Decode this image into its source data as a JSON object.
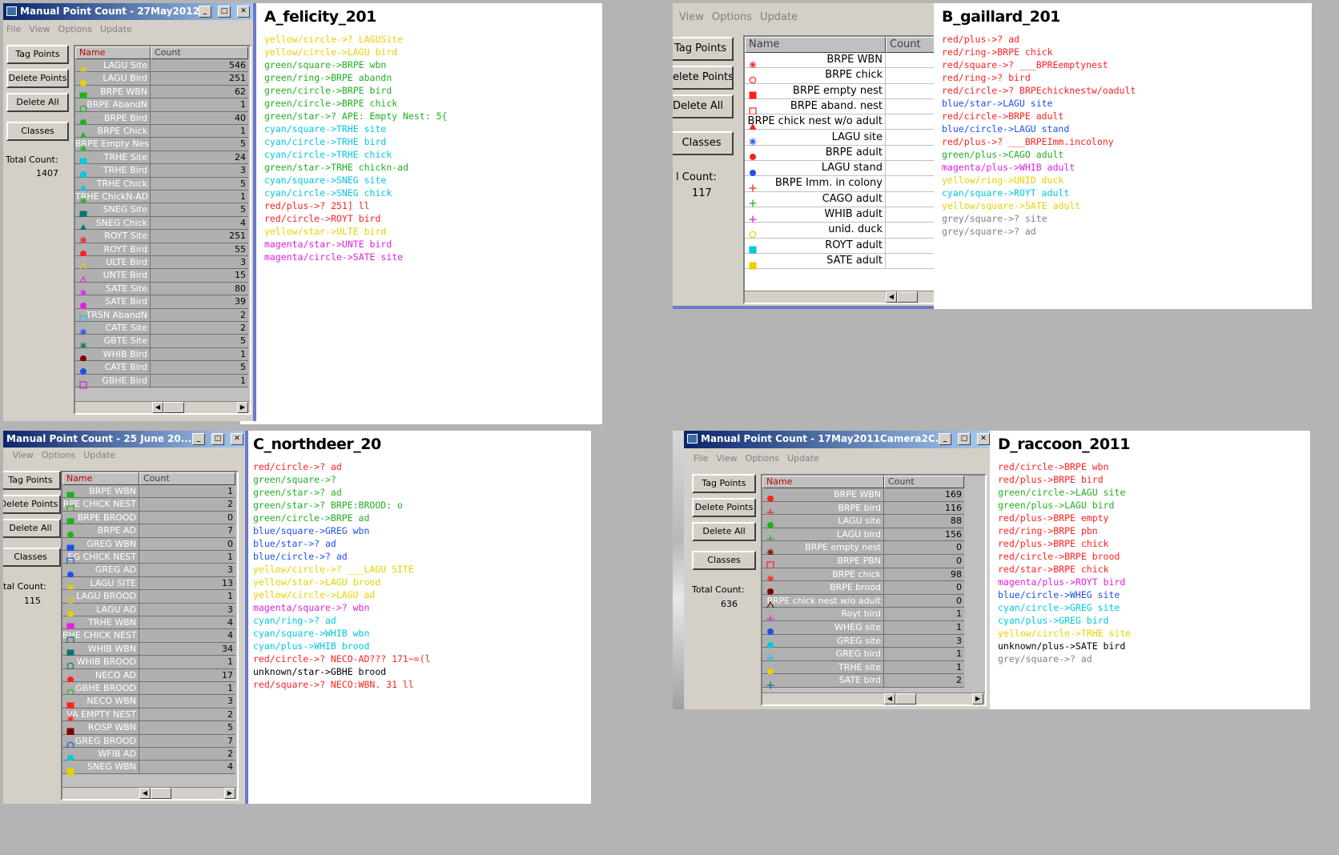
{
  "menus": [
    "File",
    "View",
    "Options",
    "Update"
  ],
  "buttons": {
    "tag": "Tag Points",
    "del": "Delete Points",
    "delall": "Delete All",
    "classes": "Classes"
  },
  "tot_label": "Total Count:",
  "cols": {
    "name": "Name",
    "count": "Count"
  },
  "colors": {
    "red": "#ff2020",
    "green": "#20b020",
    "yellow": "#e8d000",
    "cyan": "#00c8e0",
    "magenta": "#e020e0",
    "blue": "#2050e8",
    "grey": "#808080",
    "unknown": "#000000",
    "darkred": "#800000",
    "teal": "#107070"
  },
  "A": {
    "window_title": "Manual Point Count - 27May2012...",
    "total": "1407",
    "title": "A_felicity_201",
    "rows": [
      {
        "n": "LAGU Site",
        "c": "546",
        "m": "star",
        "col": "yellow"
      },
      {
        "n": "LAGU Bird",
        "c": "251",
        "m": "circle",
        "col": "yellow"
      },
      {
        "n": "BRPE WBN",
        "c": "62",
        "m": "square",
        "col": "green"
      },
      {
        "n": "BRPE AbandN",
        "c": "1",
        "m": "ring",
        "col": "green"
      },
      {
        "n": "BRPE Bird",
        "c": "40",
        "m": "circle",
        "col": "green"
      },
      {
        "n": "BRPE Chick",
        "c": "1",
        "m": "tri",
        "col": "green"
      },
      {
        "n": "BRPE Empty Nest",
        "c": "5",
        "m": "star",
        "col": "green"
      },
      {
        "n": "TRHE Site",
        "c": "24",
        "m": "square",
        "col": "cyan"
      },
      {
        "n": "TRHE Bird",
        "c": "3",
        "m": "circle",
        "col": "cyan"
      },
      {
        "n": "TRHE Chick",
        "c": "5",
        "m": "tri",
        "col": "cyan"
      },
      {
        "n": "TRHE ChickN-AD",
        "c": "1",
        "m": "star",
        "col": "green"
      },
      {
        "n": "SNEG Site",
        "c": "5",
        "m": "square",
        "col": "teal"
      },
      {
        "n": "SNEG Chick",
        "c": "4",
        "m": "tri",
        "col": "teal"
      },
      {
        "n": "ROYT Site",
        "c": "251",
        "m": "star",
        "col": "red"
      },
      {
        "n": "ROYT Bird",
        "c": "55",
        "m": "circle",
        "col": "red"
      },
      {
        "n": "ULTE Bird",
        "c": "3",
        "m": "trio",
        "col": "yellow"
      },
      {
        "n": "UNTE Bird",
        "c": "15",
        "m": "trio",
        "col": "magenta"
      },
      {
        "n": "SATE Site",
        "c": "80",
        "m": "star",
        "col": "magenta"
      },
      {
        "n": "SATE Bird",
        "c": "39",
        "m": "circle",
        "col": "magenta"
      },
      {
        "n": "TRSN AbandN",
        "c": "2",
        "m": "sqo",
        "col": "cyan"
      },
      {
        "n": "CATE Site",
        "c": "2",
        "m": "star",
        "col": "blue"
      },
      {
        "n": "GBTE Site",
        "c": "5",
        "m": "star",
        "col": "teal"
      },
      {
        "n": "WHIB Bird",
        "c": "1",
        "m": "circle",
        "col": "darkred"
      },
      {
        "n": "CATE Bird",
        "c": "5",
        "m": "circle",
        "col": "blue"
      },
      {
        "n": "GBHE Bird",
        "c": "1",
        "m": "sqo",
        "col": "magenta"
      }
    ],
    "lines": [
      {
        "t": "yellow/circle->? LAGUSite",
        "col": "yellow"
      },
      {
        "t": "yellow/circle->LAGU bird",
        "col": "yellow"
      },
      {
        "t": "green/square->BRPE wbn",
        "col": "green"
      },
      {
        "t": "green/ring->BRPE abandn",
        "col": "green"
      },
      {
        "t": "green/circle->BRPE bird",
        "col": "green"
      },
      {
        "t": "green/circle->BRPE chick",
        "col": "green"
      },
      {
        "t": "green/star->? APE: Empty Nest: 5{",
        "col": "green"
      },
      {
        "t": "cyan/square->TRHE site",
        "col": "cyan"
      },
      {
        "t": "cyan/circle->TRHE bird",
        "col": "cyan"
      },
      {
        "t": "cyan/circle->TRHE chick",
        "col": "cyan"
      },
      {
        "t": "green/star->TRHE chickn-ad",
        "col": "green"
      },
      {
        "t": "cyan/square->SNEG site",
        "col": "cyan"
      },
      {
        "t": "cyan/circle->SNEG chick",
        "col": "cyan"
      },
      {
        "t": "red/plus->? 251] ll",
        "col": "red"
      },
      {
        "t": "red/circle->ROYT bird",
        "col": "red"
      },
      {
        "t": "yellow/star->ULTE bird",
        "col": "yellow"
      },
      {
        "t": "magenta/star->UNTE bird",
        "col": "magenta"
      },
      {
        "t": "magenta/circle->SATE site",
        "col": "magenta"
      }
    ]
  },
  "B": {
    "title": "B_gaillard_201",
    "total_label": "l Count:",
    "total": "117",
    "rows": [
      {
        "n": "BRPE WBN",
        "c": "",
        "m": "star",
        "col": "red"
      },
      {
        "n": "BRPE chick",
        "c": "",
        "m": "ring",
        "col": "red"
      },
      {
        "n": "BRPE empty nest",
        "c": "",
        "m": "square",
        "col": "red"
      },
      {
        "n": "BRPE aband. nest",
        "c": "",
        "m": "sqo",
        "col": "red"
      },
      {
        "n": "BRPE chick nest w/o adult",
        "c": "",
        "m": "tri",
        "col": "red"
      },
      {
        "n": "LAGU site",
        "c": "",
        "m": "star",
        "col": "blue"
      },
      {
        "n": "BRPE adult",
        "c": "",
        "m": "circle",
        "col": "red"
      },
      {
        "n": "LAGU stand",
        "c": "",
        "m": "circle",
        "col": "blue"
      },
      {
        "n": "BRPE Imm. in colony",
        "c": "",
        "m": "plus",
        "col": "red"
      },
      {
        "n": "CAGO adult",
        "c": "",
        "m": "plus",
        "col": "green"
      },
      {
        "n": "WHIB adult",
        "c": "",
        "m": "plus",
        "col": "magenta"
      },
      {
        "n": "unid. duck",
        "c": "",
        "m": "ring",
        "col": "yellow"
      },
      {
        "n": "ROYT adult",
        "c": "",
        "m": "square",
        "col": "cyan"
      },
      {
        "n": "SATE adult",
        "c": "",
        "m": "square",
        "col": "yellow"
      }
    ],
    "lines": [
      {
        "t": "red/plus->? ad",
        "col": "red"
      },
      {
        "t": "red/ring->BRPE chick",
        "col": "red"
      },
      {
        "t": "red/square->? ___BPREemptynest",
        "col": "red"
      },
      {
        "t": "red/ring->? bird",
        "col": "red"
      },
      {
        "t": "red/circle->? BRPEchicknestw/oadult",
        "col": "red"
      },
      {
        "t": "blue/star->LAGU site",
        "col": "blue"
      },
      {
        "t": "red/circle->BRPE adult",
        "col": "red"
      },
      {
        "t": "blue/circle->LAGU stand",
        "col": "blue"
      },
      {
        "t": "red/plus->? ___BRPEImm.incolony",
        "col": "red"
      },
      {
        "t": "green/plus->CAGO adult",
        "col": "green"
      },
      {
        "t": "magenta/plus->WHIB adult",
        "col": "magenta"
      },
      {
        "t": "yellow/ring->UNID duck",
        "col": "yellow"
      },
      {
        "t": "cyan/square->ROYT adult",
        "col": "cyan"
      },
      {
        "t": "yellow/square->SATE adult",
        "col": "yellow"
      },
      {
        "t": "grey/square->? site",
        "col": "grey"
      },
      {
        "t": "grey/square->? ad",
        "col": "grey"
      }
    ]
  },
  "C": {
    "window_title": "Manual Point Count - 25 June 20...",
    "title": "C_northdeer_20",
    "total_label": "tal Count:",
    "total": "115",
    "rows": [
      {
        "n": "BRPE WBN",
        "c": "1",
        "m": "square",
        "col": "green"
      },
      {
        "n": "RPE CHICK NEST",
        "c": "2",
        "m": "sqo",
        "col": "green"
      },
      {
        "n": "BRPE BROOD",
        "c": "0",
        "m": "square",
        "col": "green"
      },
      {
        "n": "BRPE AD",
        "c": "7",
        "m": "circle",
        "col": "green"
      },
      {
        "n": "GREG WBN",
        "c": "0",
        "m": "square",
        "col": "blue"
      },
      {
        "n": "EG CHICK NEST",
        "c": "1",
        "m": "sqo",
        "col": "blue"
      },
      {
        "n": "GREG AD",
        "c": "3",
        "m": "circle",
        "col": "blue"
      },
      {
        "n": "LAGU SITE",
        "c": "13",
        "m": "star",
        "col": "yellow"
      },
      {
        "n": "LAGU BROOD",
        "c": "1",
        "m": "ring",
        "col": "yellow"
      },
      {
        "n": "LAGU AD",
        "c": "3",
        "m": "circle",
        "col": "yellow"
      },
      {
        "n": "TRHE WBN",
        "c": "4",
        "m": "square",
        "col": "magenta"
      },
      {
        "n": "BHE CHICK NEST",
        "c": "4",
        "m": "sqo",
        "col": "teal"
      },
      {
        "n": "WHIB WBN",
        "c": "34",
        "m": "square",
        "col": "teal"
      },
      {
        "n": "WHIB BROOD",
        "c": "1",
        "m": "ring",
        "col": "teal"
      },
      {
        "n": "NECO AD",
        "c": "17",
        "m": "circle",
        "col": "red"
      },
      {
        "n": "GBHE BROOD",
        "c": "1",
        "m": "ring",
        "col": "green"
      },
      {
        "n": "NECO WBN",
        "c": "3",
        "m": "square",
        "col": "red"
      },
      {
        "n": "VA EMPTY NEST",
        "c": "2",
        "m": "star",
        "col": "red"
      },
      {
        "n": "ROSP WBN",
        "c": "5",
        "m": "square",
        "col": "darkred"
      },
      {
        "n": "GREG BROOD",
        "c": "7",
        "m": "ring",
        "col": "blue"
      },
      {
        "n": "WFIB AD",
        "c": "2",
        "m": "circle",
        "col": "cyan"
      },
      {
        "n": "SNEG WBN",
        "c": "4",
        "m": "square",
        "col": "yellow"
      }
    ],
    "lines": [
      {
        "t": "red/circle->? ad",
        "col": "red"
      },
      {
        "t": "green/square->?",
        "col": "green"
      },
      {
        "t": "green/star->? ad",
        "col": "green"
      },
      {
        "t": "green/star->? BRPE:BROOD: o",
        "col": "green"
      },
      {
        "t": "green/circle->BRPE ad",
        "col": "green"
      },
      {
        "t": "blue/square->GREG wbn",
        "col": "blue"
      },
      {
        "t": "blue/star->? ad",
        "col": "blue"
      },
      {
        "t": "blue/circle->? ad",
        "col": "blue"
      },
      {
        "t": "yellow/circle->? ___LAGU SITE",
        "col": "yellow"
      },
      {
        "t": "yellow/star->LAGU brood",
        "col": "yellow"
      },
      {
        "t": "yellow/circle->LAGU ad",
        "col": "yellow"
      },
      {
        "t": "magenta/square->? wbn",
        "col": "magenta"
      },
      {
        "t": "cyan/ring->? ad",
        "col": "cyan"
      },
      {
        "t": "cyan/square->WHIB wbn",
        "col": "cyan"
      },
      {
        "t": "cyan/plus->WHIB brood",
        "col": "cyan"
      },
      {
        "t": "red/circle->? NECO-AD??? 171~=(l",
        "col": "red"
      },
      {
        "t": "unknown/star->GBHE brood",
        "col": "unknown"
      },
      {
        "t": "red/square->? NECO:WBN. 31 ll",
        "col": "red"
      }
    ]
  },
  "D": {
    "window_title": "Manual Point Count - 17May2011Camera2C...",
    "title": "D_raccoon_2011",
    "total": "636",
    "rows": [
      {
        "n": "BRPE WBN",
        "c": "169",
        "m": "circle",
        "col": "red"
      },
      {
        "n": "BRPE bird",
        "c": "116",
        "m": "plus",
        "col": "red"
      },
      {
        "n": "LAGU site",
        "c": "88",
        "m": "circle",
        "col": "green"
      },
      {
        "n": "LAGU bird",
        "c": "156",
        "m": "plus",
        "col": "green"
      },
      {
        "n": "BRPE empty nest",
        "c": "0",
        "m": "star",
        "col": "darkred"
      },
      {
        "n": "BRPE PBN",
        "c": "0",
        "m": "sqo",
        "col": "red"
      },
      {
        "n": "BRPE chick",
        "c": "98",
        "m": "star",
        "col": "red"
      },
      {
        "n": "BRPE brood",
        "c": "0",
        "m": "circle",
        "col": "darkred"
      },
      {
        "n": "BRPE chick nest w/o adult",
        "c": "0",
        "m": "trio",
        "col": "darkred"
      },
      {
        "n": "Royt bird",
        "c": "1",
        "m": "plus",
        "col": "magenta"
      },
      {
        "n": "WHEG site",
        "c": "1",
        "m": "circle",
        "col": "blue"
      },
      {
        "n": "GREG site",
        "c": "3",
        "m": "circle",
        "col": "cyan"
      },
      {
        "n": "GREG bird",
        "c": "1",
        "m": "plus",
        "col": "cyan"
      },
      {
        "n": "TRHE site",
        "c": "1",
        "m": "circle",
        "col": "yellow"
      },
      {
        "n": "SATE bird",
        "c": "2",
        "m": "plus",
        "col": "teal"
      }
    ],
    "lines": [
      {
        "t": "red/circle->BRPE wbn",
        "col": "red"
      },
      {
        "t": "red/plus->BRPE bird",
        "col": "red"
      },
      {
        "t": "green/circle->LAGU site",
        "col": "green"
      },
      {
        "t": "green/plus->LAGU bird",
        "col": "green"
      },
      {
        "t": "red/plus->BRPE empty",
        "col": "red"
      },
      {
        "t": "red/ring->BRPE pbn",
        "col": "red"
      },
      {
        "t": "red/plus->BRPE chick",
        "col": "red"
      },
      {
        "t": "red/circle->BRPE brood",
        "col": "red"
      },
      {
        "t": "red/star->BRPE chick",
        "col": "red"
      },
      {
        "t": "magenta/plus->ROYT bird",
        "col": "magenta"
      },
      {
        "t": "blue/circle->WHEG site",
        "col": "blue"
      },
      {
        "t": "cyan/circle->GREG site",
        "col": "cyan"
      },
      {
        "t": "cyan/plus->GREG bird",
        "col": "cyan"
      },
      {
        "t": "yellow/circle->TRHE site",
        "col": "yellow"
      },
      {
        "t": "unknown/plus->SATE bird",
        "col": "unknown"
      },
      {
        "t": "grey/square->? ad",
        "col": "grey"
      }
    ]
  }
}
